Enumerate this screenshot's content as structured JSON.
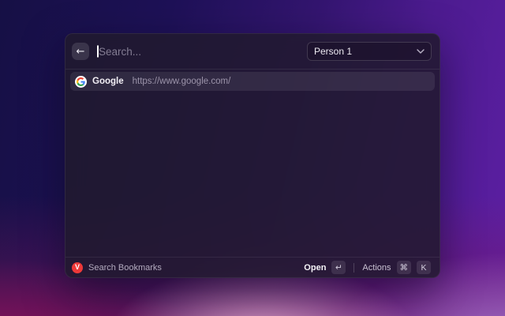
{
  "dialog": {
    "header": {
      "back_icon": "←",
      "search": {
        "value": "",
        "placeholder": "Search..."
      },
      "profile": {
        "value": "Person 1"
      }
    },
    "results": [
      {
        "title": "Google",
        "url": "https://www.google.com/"
      }
    ],
    "footer": {
      "mode_label": "Search Bookmarks",
      "open_label": "Open",
      "open_key": "↵",
      "actions_label": "Actions",
      "actions_key_cmd": "⌘",
      "actions_key_letter": "K",
      "vivaldi_letter": "V"
    }
  },
  "colors": {
    "vivaldi_red": "#ee3939",
    "wallpaper_top_left": "#161045",
    "wallpaper_top_right": "#5d1fa4",
    "wallpaper_bottom_pink": "#e2a8ce",
    "dialog_background": "rgba(33,26,45,0.86)"
  }
}
